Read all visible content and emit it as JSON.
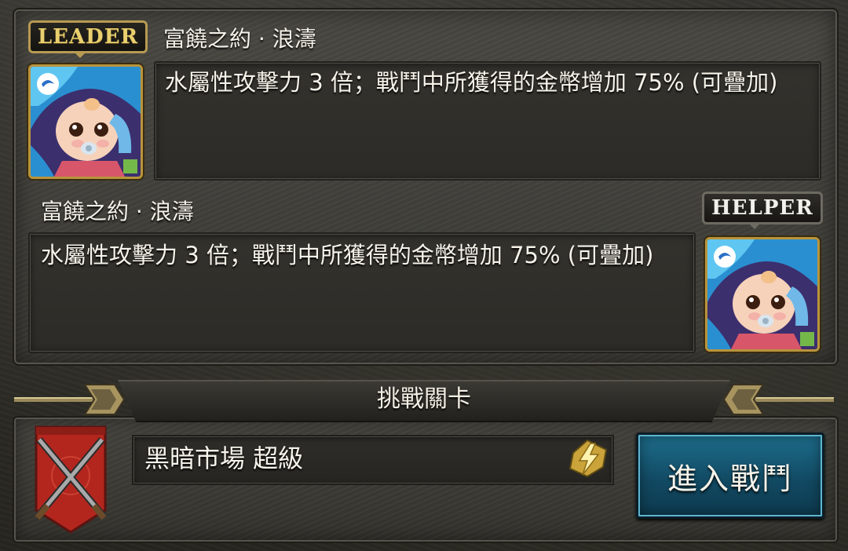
{
  "team": {
    "leader": {
      "badge": "LEADER",
      "skill_name": "富饒之約 · 浪濤",
      "skill_desc": "水屬性攻擊力 3 倍；戰鬥中所獲得的金幣增加 75% (可疊加)",
      "icon": "baby-card-portrait-icon"
    },
    "helper": {
      "badge": "HELPER",
      "skill_name": "富饒之約 · 浪濤",
      "skill_desc": "水屬性攻擊力 3 倍；戰鬥中所獲得的金幣增加 75% (可疊加)",
      "icon": "baby-card-portrait-icon"
    }
  },
  "stage": {
    "header": "挑戰關卡",
    "name": "黑暗市場 超級",
    "icon": "crossed-swords-banner-icon",
    "bonus_icon": "lightning-bolt-icon",
    "enter_button": "進入戰鬥"
  },
  "colors": {
    "leader_badge": "#e9cf6e",
    "button_bg": "#1e6f8e",
    "panel_bg": "#3b3a35"
  }
}
